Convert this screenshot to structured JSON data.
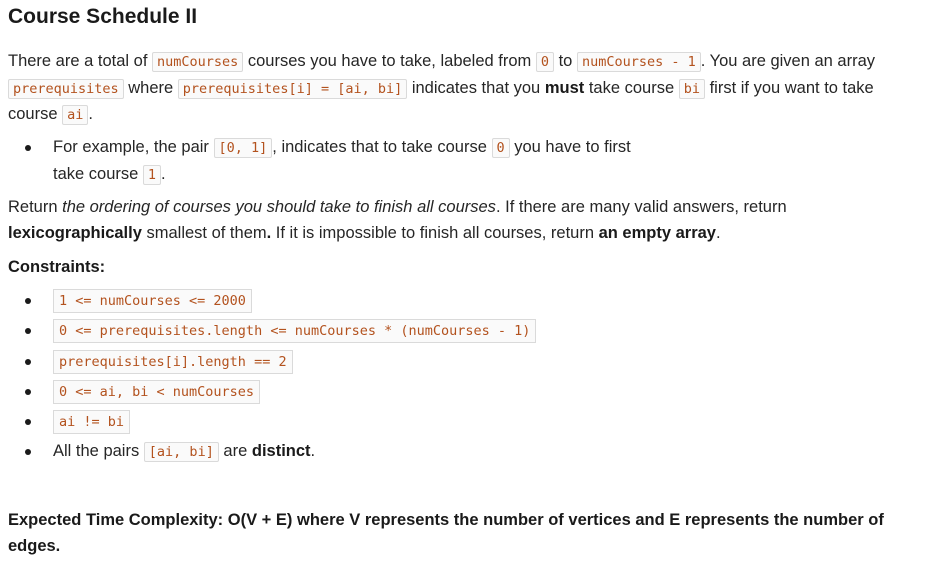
{
  "title": "Course Schedule II",
  "intro": {
    "t1": "There are a total of ",
    "c1": "numCourses",
    "t2": " courses you have to take, labeled from ",
    "c2": "0",
    "t3": " to ",
    "c3": "numCourses - 1",
    "t4": ". You are given an array ",
    "c4": "prerequisites",
    "t5": " where ",
    "c5": "prerequisites[i] = [ai, bi]",
    "t6": " indicates that you ",
    "b1": "must",
    "t7": " take course ",
    "c6": "bi",
    "t8": " first if you want to take course ",
    "c7": "ai",
    "t9": "."
  },
  "example": {
    "t1": "For example, the pair ",
    "c1": "[0, 1]",
    "t2": ", indicates that to take course ",
    "c2": "0",
    "t3": " you have to first",
    "t4": "take course ",
    "c3": "1",
    "t5": "."
  },
  "return_text": {
    "t1": "Return ",
    "i1": "the ordering of courses you should take to finish all courses",
    "t2": ". If there are many valid answers, return ",
    "b1": "lexicographically",
    "t3": " smallest of them",
    "b2": ".",
    "t4": " If it is impossible to finish all courses, return ",
    "b3": "an empty array",
    "t5": "."
  },
  "constraints_heading": "Constraints:",
  "constraints": [
    "1 <= numCourses <= 2000",
    "0 <= prerequisites.length <= numCourses * (numCourses - 1)",
    "prerequisites[i].length == 2",
    "0 <= ai, bi < numCourses",
    "ai != bi"
  ],
  "last_constraint": {
    "t1": "All the pairs ",
    "c1": "[ai, bi]",
    "t2": " are ",
    "b1": "distinct",
    "t3": "."
  },
  "complexity": "Expected Time Complexity: O(V + E) where V represents the number of vertices and E represents the number of edges."
}
